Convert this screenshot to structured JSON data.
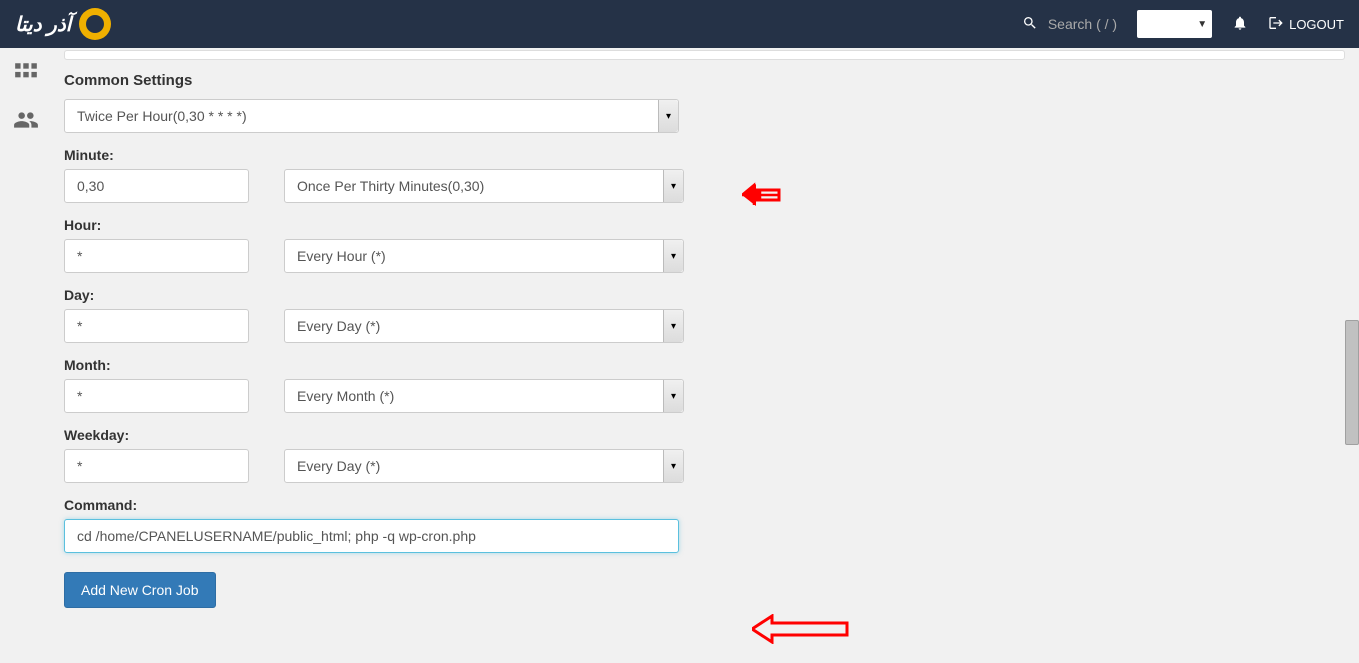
{
  "header": {
    "logo_text": "آذر دیتا",
    "search_placeholder": "Search ( / )",
    "logout_label": "LOGOUT"
  },
  "form": {
    "common_settings_label": "Common Settings",
    "common_settings_value": "Twice Per Hour(0,30 * * * *)",
    "minute": {
      "label": "Minute:",
      "value": "0,30",
      "preset": "Once Per Thirty Minutes(0,30)"
    },
    "hour": {
      "label": "Hour:",
      "value": "*",
      "preset": "Every Hour (*)"
    },
    "day": {
      "label": "Day:",
      "value": "*",
      "preset": "Every Day (*)"
    },
    "month": {
      "label": "Month:",
      "value": "*",
      "preset": "Every Month (*)"
    },
    "weekday": {
      "label": "Weekday:",
      "value": "*",
      "preset": "Every Day (*)"
    },
    "command": {
      "label": "Command:",
      "value": "cd /home/CPANELUSERNAME/public_html; php -q wp-cron.php"
    },
    "submit_label": "Add New Cron Job"
  }
}
